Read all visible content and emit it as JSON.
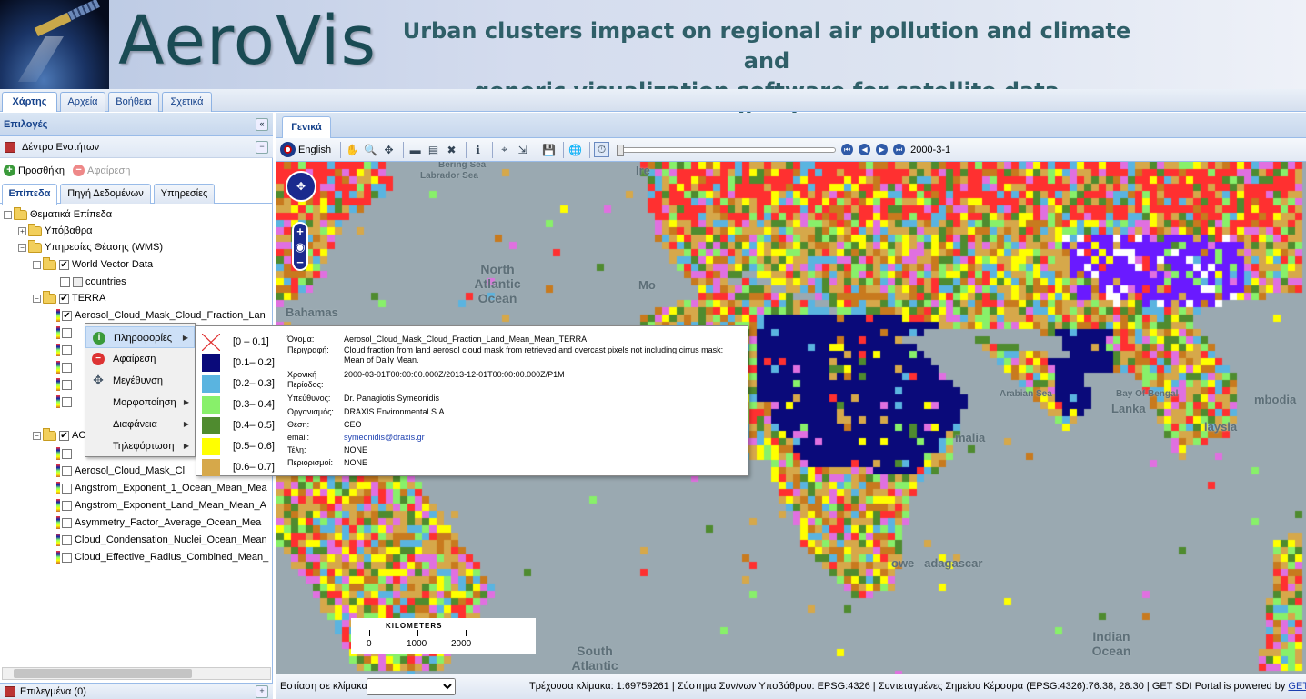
{
  "banner": {
    "logo": "AeroVis",
    "subtitle_line1": "Urban clusters impact on regional air pollution and climate and",
    "subtitle_line2": "generic visualization software for satellite data applications"
  },
  "main_tabs": [
    {
      "label": "Χάρτης",
      "active": true
    },
    {
      "label": "Αρχεία",
      "active": false
    },
    {
      "label": "Βοήθεια",
      "active": false
    },
    {
      "label": "Σχετικά",
      "active": false
    }
  ],
  "left_panel": {
    "title": "Επιλογές",
    "tree_header": "Δέντρο Ενοτήτων",
    "add_button": "Προσθήκη",
    "remove_button": "Αφαίρεση",
    "tabs": [
      "Επίπεδα",
      "Πηγή Δεδομένων",
      "Υπηρεσίες"
    ],
    "tree": {
      "root": "Θεματικά Επίπεδα",
      "basemaps": "Υπόβαθρα",
      "wms": "Υπηρεσίες Θέασης (WMS)",
      "world_vector": "World Vector Data",
      "countries": "countries",
      "terra": "TERRA",
      "terra_layer": "Aerosol_Cloud_Mask_Cloud_Fraction_Lan",
      "ac_folder": "AC",
      "layers": [
        "Aerosol_Cloud_Mask_Cl",
        "Angstrom_Exponent_1_Ocean_Mean_Mea",
        "Angstrom_Exponent_Land_Mean_Mean_A",
        "Asymmetry_Factor_Average_Ocean_Mea",
        "Cloud_Condensation_Nuclei_Ocean_Mean",
        "Cloud_Effective_Radius_Combined_Mean_"
      ]
    },
    "selected_footer": "Επιλεγμένα (0)"
  },
  "right_panel": {
    "tab": "Γενικά",
    "language": "English",
    "date": "2000-3-1"
  },
  "context_menu": {
    "items": [
      {
        "label": "Πληροφορίες",
        "icon": "info-icon",
        "submenu": true
      },
      {
        "label": "Αφαίρεση",
        "icon": "remove-icon",
        "submenu": false
      },
      {
        "label": "Μεγέθυνση",
        "icon": "zoom-extent-icon",
        "submenu": false
      },
      {
        "label": "Μορφοποίηση",
        "icon": "",
        "submenu": true
      },
      {
        "label": "Διαφάνεια",
        "icon": "",
        "submenu": true
      },
      {
        "label": "Τηλεφόρτωση",
        "icon": "",
        "submenu": true
      }
    ]
  },
  "legend": [
    {
      "label": "[0 – 0.1]",
      "color": "none"
    },
    {
      "label": "[0.1– 0.2]",
      "color": "#0a0a7a"
    },
    {
      "label": "[0.2– 0.3]",
      "color": "#5ab4e0"
    },
    {
      "label": "[0.3– 0.4]",
      "color": "#88f06a"
    },
    {
      "label": "[0.4– 0.5]",
      "color": "#4f8b2f"
    },
    {
      "label": "[0.5– 0.6]",
      "color": "#ffff00"
    },
    {
      "label": "[0.6– 0.7]",
      "color": "#d6a84a"
    }
  ],
  "layer_info": [
    {
      "key": "Όνομα:",
      "value": "Aerosol_Cloud_Mask_Cloud_Fraction_Land_Mean_Mean_TERRA"
    },
    {
      "key": "Περιγραφή:",
      "value": "Cloud fraction from land aerosol cloud mask from retrieved and overcast pixels not including cirrus mask: Mean of Daily Mean."
    },
    {
      "key": "Χρονική Περίοδος:",
      "value": "2000-03-01T00:00:00.000Z/2013-12-01T00:00:00.000Z/P1M"
    },
    {
      "key": "Υπεύθυνος:",
      "value": "Dr. Panagiotis Symeonidis"
    },
    {
      "key": "Οργανισμός:",
      "value": "DRAXIS Environmental S.A."
    },
    {
      "key": "Θέση:",
      "value": "CEO"
    },
    {
      "key": "email:",
      "value": "symeonidis@draxis.gr"
    },
    {
      "key": "Τέλη:",
      "value": "NONE"
    },
    {
      "key": "Περιορισμοί:",
      "value": "NONE"
    }
  ],
  "map_labels": {
    "bering": "Bering Sea",
    "labrador": "Labrador Sea",
    "north_atlantic": "North Atlantic Ocean",
    "bahamas": "Bahamas",
    "arabian": "Arabian Sea",
    "bengal": "Bay Of Bengal",
    "lanka": "Lanka",
    "somalia": "malia",
    "madagascar": "owe   adagascar",
    "south_atlantic": "South Atlantic",
    "indian": "Indian Ocean",
    "malaysia": "laysia",
    "cambodia": "mbodia",
    "ire": "Ire",
    "mo": "Mo"
  },
  "scalebar": {
    "title": "KILOMETERS",
    "ticks": [
      "0",
      "1000",
      "2000"
    ]
  },
  "status": {
    "zoom_label": "Εστίαση σε κλίμακα:",
    "scale": "Τρέχουσα κλίμακα: 1:69759261",
    "crs": "Σύστημα Συν/νων Υποβάθρου: EPSG:4326",
    "cursor": "Συντεταγμένες Σημείου Κέρσορα (EPSG:4326):76.38, 28.30",
    "powered": "GET SDI Portal is powered by",
    "powered_link": "GET Ltd"
  }
}
